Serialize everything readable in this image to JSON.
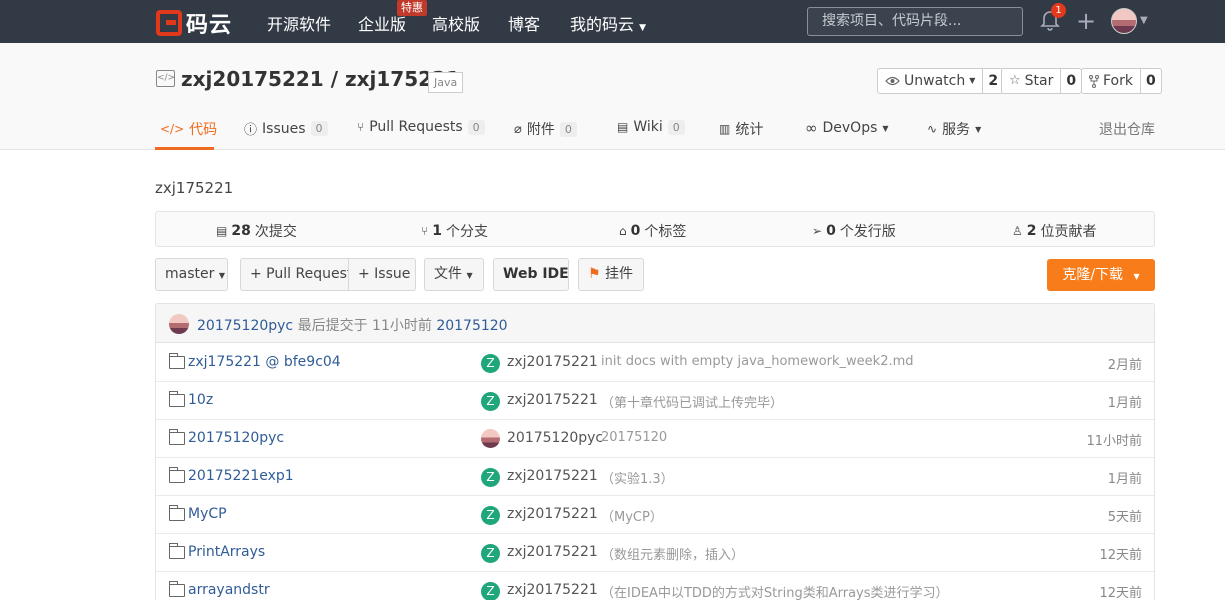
{
  "nav": {
    "logo_text": "码云",
    "items": [
      "开源软件",
      "企业版",
      "高校版",
      "博客",
      "我的码云"
    ],
    "badge": "特惠",
    "search_placeholder": "搜索项目、代码片段...",
    "notification_count": "1"
  },
  "repo": {
    "owner": "zxj20175221",
    "separator": " / ",
    "name": "zxj175221",
    "language": "Java",
    "unwatch_label": "Unwatch",
    "unwatch_count": "2",
    "star_label": "Star",
    "star_count": "0",
    "fork_label": "Fork",
    "fork_count": "0"
  },
  "tabs": [
    {
      "label": "代码",
      "count": ""
    },
    {
      "label": "Issues",
      "count": "0"
    },
    {
      "label": "Pull Requests",
      "count": "0"
    },
    {
      "label": "附件",
      "count": "0"
    },
    {
      "label": "Wiki",
      "count": "0"
    },
    {
      "label": "统计",
      "count": ""
    },
    {
      "label": "DevOps",
      "count": ""
    },
    {
      "label": "服务",
      "count": ""
    }
  ],
  "exit_repo": "退出仓库",
  "description": "zxj175221",
  "stats": {
    "commits_num": "28",
    "commits_label": "次提交",
    "branches_num": "1",
    "branches_label": "个分支",
    "tags_num": "0",
    "tags_label": "个标签",
    "releases_num": "0",
    "releases_label": "个发行版",
    "contributors_num": "2",
    "contributors_label": "位贡献者"
  },
  "toolbar": {
    "branch": "master",
    "pull_request": "+ Pull Request",
    "issue": "+ Issue",
    "file": "文件",
    "web_ide": "Web IDE",
    "widget": "挂件",
    "clone": "克隆/下载"
  },
  "last_commit": {
    "author": "20175120pyc",
    "text": "最后提交于",
    "time": "11小时前",
    "message": "20175120"
  },
  "files": [
    {
      "name": "zxj175221 @ bfe9c04",
      "avatar": "Z",
      "author": "zxj20175221",
      "message": "init docs with empty java_homework_week2.md",
      "time": "2月前"
    },
    {
      "name": "10z",
      "avatar": "Z",
      "author": "zxj20175221",
      "message": "（第十章代码已调试上传完毕）",
      "time": "1月前"
    },
    {
      "name": "20175120pyc",
      "avatar": "",
      "author": "20175120pyc",
      "message": "20175120",
      "time": "11小时前"
    },
    {
      "name": "20175221exp1",
      "avatar": "Z",
      "author": "zxj20175221",
      "message": "（实验1.3）",
      "time": "1月前"
    },
    {
      "name": "MyCP",
      "avatar": "Z",
      "author": "zxj20175221",
      "message": "（MyCP）",
      "time": "5天前"
    },
    {
      "name": "PrintArrays",
      "avatar": "Z",
      "author": "zxj20175221",
      "message": "（数组元素删除，插入）",
      "time": "12天前"
    },
    {
      "name": "arrayandstr",
      "avatar": "Z",
      "author": "zxj20175221",
      "message": "（在IDEA中以TDD的方式对String类和Arrays类进行学习）",
      "time": "12天前"
    }
  ]
}
